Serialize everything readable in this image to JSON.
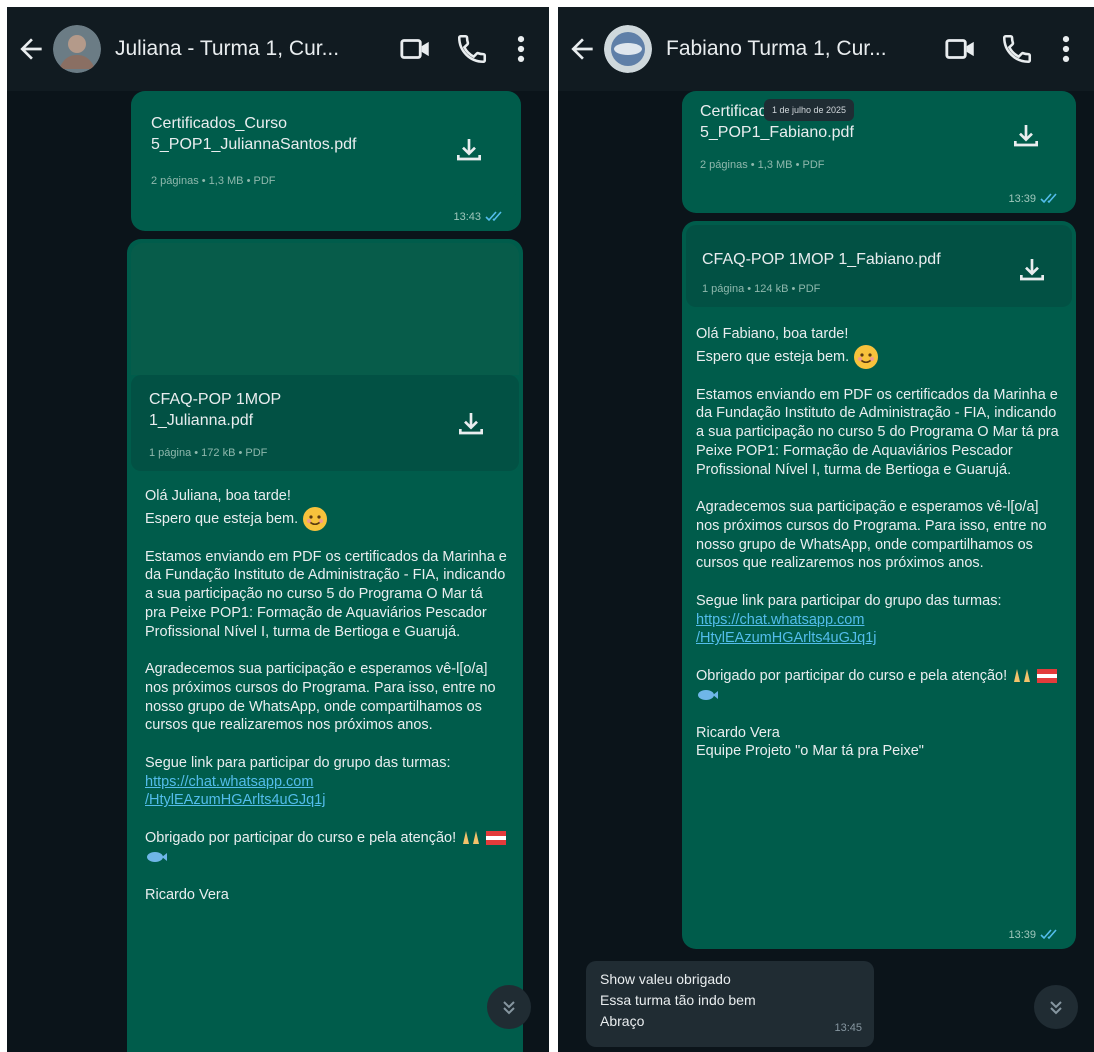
{
  "left": {
    "title": "Juliana - Turma 1, Cur...",
    "doc1": {
      "name_line1": "Certificados_Curso",
      "name_line2": "5_POP1_JuliannaSantos.pdf",
      "meta": "2 páginas • 1,3 MB • PDF",
      "time": "13:43"
    },
    "doc2": {
      "name_line1": "CFAQ-POP 1MOP",
      "name_line2": "1_Julianna.pdf",
      "meta": "1 página • 172 kB • PDF"
    },
    "message": {
      "greeting": "Olá Juliana, boa tarde!",
      "wish": "Espero que esteja bem.",
      "p1": "Estamos enviando em PDF os certificados da Marinha e da Fundação Instituto de Administração - FIA, indicando a sua participação no curso 5 do Programa O Mar tá pra Peixe POP1: Formação de Aquaviários Pescador Profissional Nível I, turma de Bertioga e Guarujá.",
      "p2": "Agradecemos sua participação e esperamos vê-l[o/a] nos próximos cursos do Programa. Para isso, entre no nosso grupo de WhatsApp, onde compartilhamos os cursos que realizaremos nos próximos anos.",
      "link_intro": "Segue link para participar do grupo das turmas:",
      "link_line1": "https://chat.whatsapp.com",
      "link_line2": "/HtylEAzumHGArlts4uGJq1j",
      "thanks": "Obrigado por participar do curso e pela atenção!",
      "signature": "Ricardo Vera"
    }
  },
  "right": {
    "title": "Fabiano Turma 1, Cur...",
    "date_chip": "1 de julho de 2025",
    "doc1": {
      "name_line1": "Certificados_Curso",
      "name_line2": "5_POP1_Fabiano.pdf",
      "meta": "2 páginas • 1,3 MB • PDF",
      "time": "13:39"
    },
    "doc2": {
      "name": "CFAQ-POP 1MOP 1_Fabiano.pdf",
      "meta": "1 página • 124 kB • PDF"
    },
    "message": {
      "greeting": "Olá Fabiano, boa tarde!",
      "wish": "Espero que esteja bem.",
      "p1": "Estamos enviando em PDF os certificados da Marinha e da Fundação Instituto de Administração - FIA, indicando a sua participação no curso 5 do Programa O Mar tá pra Peixe POP1: Formação de Aquaviários Pescador Profissional Nível I, turma de Bertioga e Guarujá.",
      "p2": "Agradecemos sua participação e esperamos vê-l[o/a] nos próximos cursos do Programa. Para isso, entre no nosso grupo de WhatsApp, onde compartilhamos os cursos que realizaremos nos próximos anos.",
      "link_intro": "Segue link para participar do grupo das turmas:",
      "link_line1": "https://chat.whatsapp.com",
      "link_line2": "/HtylEAzumHGArlts4uGJq1j",
      "thanks": "Obrigado por participar do curso e pela atenção!",
      "signature": "Ricardo Vera",
      "team": "Equipe Projeto \"o Mar tá pra Peixe\"",
      "time": "13:39"
    },
    "reply": {
      "line1": "Show valeu obrigado",
      "line2": "Essa turma tão indo bem",
      "line3": "Abraço",
      "time": "13:45"
    }
  },
  "colors": {
    "outgoing_bubble": "#005c4b",
    "incoming_bubble": "#202c33",
    "chat_bg": "#0b141a",
    "header_bg": "#111b21",
    "link": "#53bdeb",
    "read_ticks": "#53bdeb"
  },
  "icons": [
    "back-arrow-icon",
    "video-call-icon",
    "voice-call-icon",
    "more-options-icon",
    "download-icon",
    "read-ticks-icon",
    "scroll-down-icon",
    "smiling-face-emoji",
    "praying-hands-emoji",
    "fish-emoji"
  ]
}
